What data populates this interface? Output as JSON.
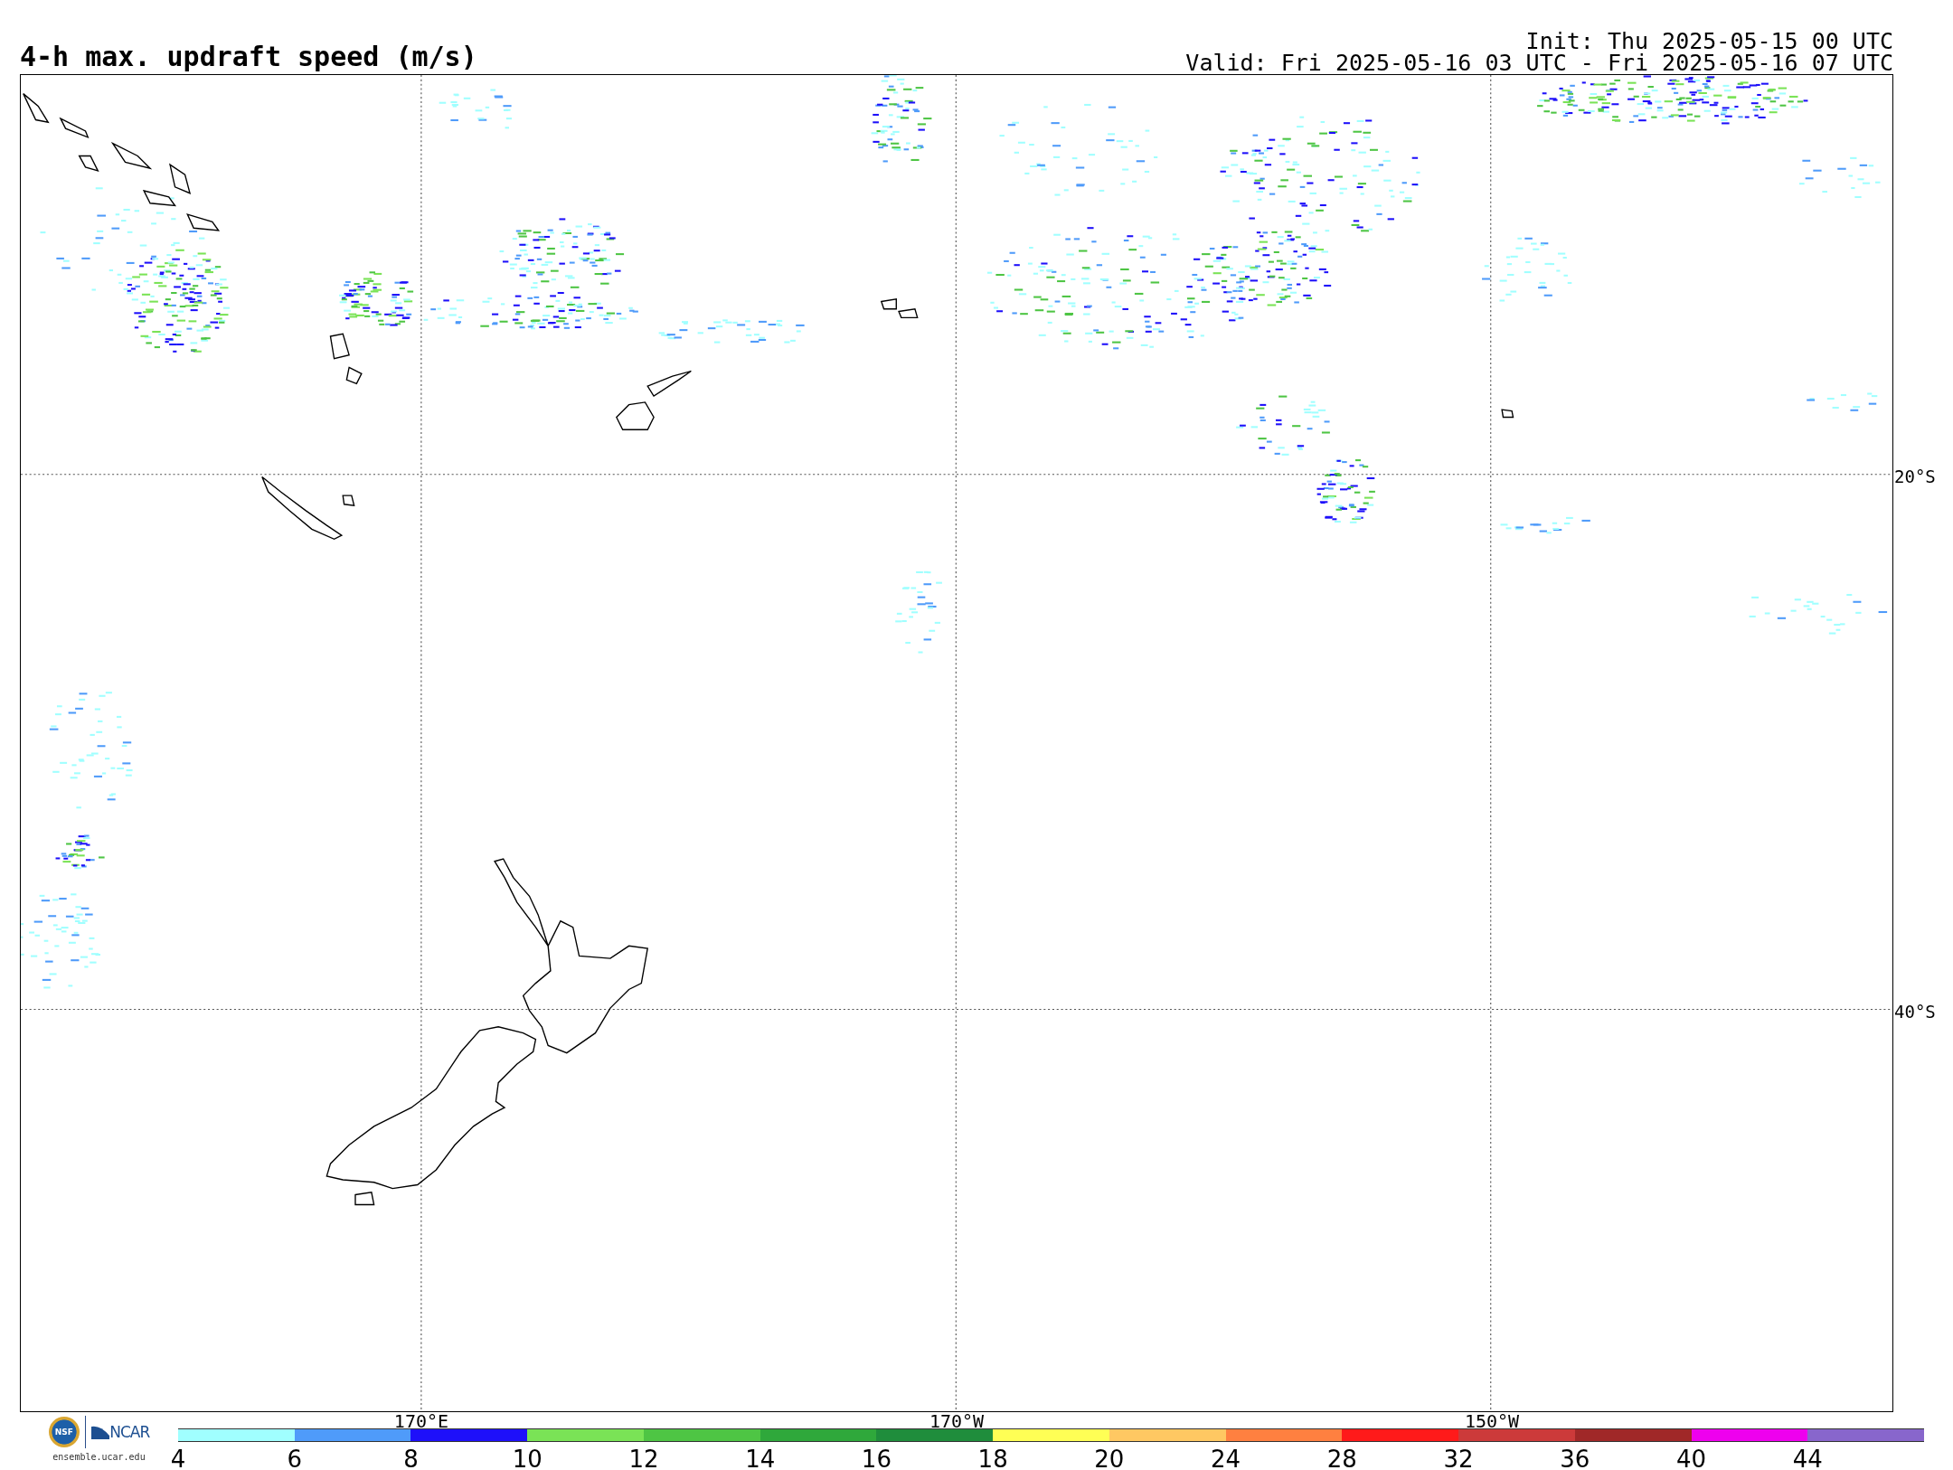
{
  "title": "4-h max. updraft speed (m/s)",
  "init": "Init: Thu 2025-05-15 00 UTC",
  "valid": "Valid: Fri 2025-05-16 03 UTC - Fri 2025-05-16 07 UTC",
  "map": {
    "lat_labels": [
      "20°S",
      "40°S"
    ],
    "lon_labels": [
      "170°E",
      "170°W",
      "150°W"
    ]
  },
  "logos": {
    "seal": "NSF",
    "brand": "NCAR",
    "site": "ensemble.ucar.edu"
  },
  "colorbar": {
    "bins": [
      {
        "color": "#a0ffff"
      },
      {
        "color": "#4f9bfa"
      },
      {
        "color": "#1e10fa"
      },
      {
        "color": "#7ae356"
      },
      {
        "color": "#4ec544"
      },
      {
        "color": "#2fa83b"
      },
      {
        "color": "#1f8d3c"
      },
      {
        "color": "#ffff55"
      },
      {
        "color": "#ffc862"
      },
      {
        "color": "#ff8040"
      },
      {
        "color": "#ff1a1a"
      },
      {
        "color": "#cc3a3a"
      },
      {
        "color": "#a02828"
      },
      {
        "color": "#ee00ee"
      },
      {
        "color": "#8866cc"
      }
    ],
    "ticks": [
      "4",
      "6",
      "8",
      "10",
      "12",
      "14",
      "16",
      "18",
      "20",
      "24",
      "28",
      "32",
      "36",
      "40",
      "44"
    ]
  }
}
